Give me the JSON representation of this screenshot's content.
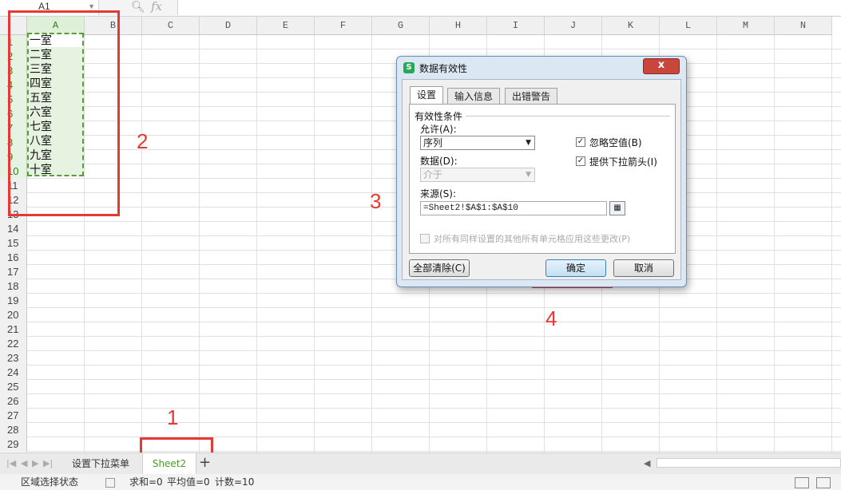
{
  "formula_bar": {
    "name_box": "A1",
    "fx": "fx"
  },
  "columns": [
    "A",
    "B",
    "C",
    "D",
    "E",
    "F",
    "G",
    "H",
    "I",
    "J",
    "K",
    "L",
    "M",
    "N"
  ],
  "rows": [
    "1",
    "2",
    "3",
    "4",
    "5",
    "6",
    "7",
    "8",
    "9",
    "10",
    "11",
    "12",
    "13",
    "14",
    "15",
    "16",
    "17",
    "18",
    "19",
    "20",
    "21",
    "22",
    "23",
    "24",
    "25",
    "26",
    "27",
    "28",
    "29"
  ],
  "cells_a": [
    "一室",
    "二室",
    "三室",
    "四室",
    "五室",
    "六室",
    "七室",
    "八室",
    "九室",
    "十室"
  ],
  "annotations": [
    "1",
    "2",
    "3",
    "4"
  ],
  "sheet_tabs": {
    "tab1": "设置下拉菜单",
    "tab2": "Sheet2",
    "add": "+"
  },
  "status": {
    "mode": "区域选择状态",
    "sum": "求和=0",
    "avg": "平均值=0",
    "count": "计数=10"
  },
  "dialog": {
    "title": "数据有效性",
    "close": "x",
    "tabs": [
      "设置",
      "输入信息",
      "出错警告"
    ],
    "section_title": "有效性条件",
    "allow_label": "允许(A):",
    "allow_value": "序列",
    "data_label": "数据(D):",
    "data_value": "介于",
    "ignore_blank": "忽略空值(B)",
    "dropdown": "提供下拉箭头(I)",
    "source_label": "来源(S):",
    "source_value": "=Sheet2!$A$1:$A$10",
    "apply_all": "对所有同样设置的其他所有单元格应用这些更改(P)",
    "clear_all": "全部清除(C)",
    "ok": "确定",
    "cancel": "取消"
  }
}
